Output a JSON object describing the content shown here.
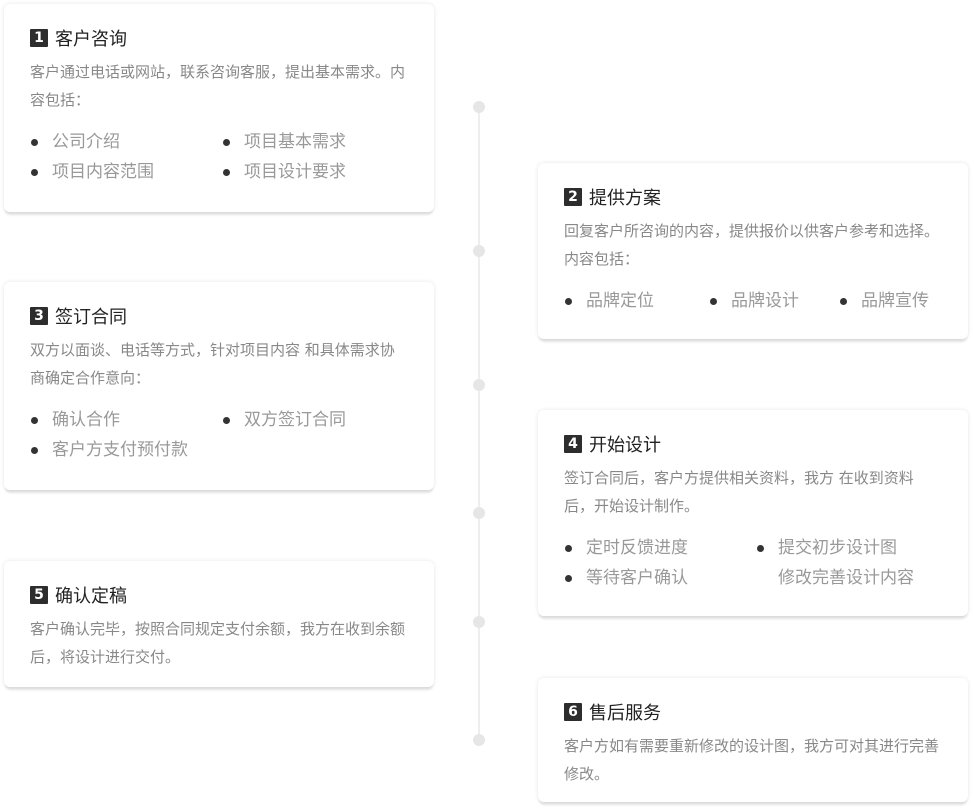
{
  "steps": [
    {
      "num": "1",
      "title": "客户咨询",
      "desc": "客户通过电话或网站，联系咨询客服，提出基本需求。内容包括：",
      "bullets": [
        "公司介绍",
        "项目基本需求",
        "项目内容范围",
        "项目设计要求"
      ]
    },
    {
      "num": "2",
      "title": "提供方案",
      "desc": "回复客户所咨询的内容，提供报价以供客户参考和选择。内容包括：",
      "bullets": [
        "品牌定位",
        "品牌设计",
        "品牌宣传"
      ]
    },
    {
      "num": "3",
      "title": "签订合同",
      "desc": "双方以面谈、电话等方式，针对项目内容 和具体需求协商确定合作意向：",
      "bullets": [
        "确认合作",
        "双方签订合同",
        "客户方支付预付款"
      ]
    },
    {
      "num": "4",
      "title": "开始设计",
      "desc": "签订合同后，客户方提供相关资料，我方 在收到资料后，开始设计制作。",
      "bullets": [
        "定时反馈进度",
        "提交初步设计图",
        "等待客户确认",
        "修改完善设计内容"
      ]
    },
    {
      "num": "5",
      "title": "确认定稿",
      "desc": "客户确认完毕，按照合同规定支付余额，我方在收到余额后，将设计进行交付。",
      "bullets": []
    },
    {
      "num": "6",
      "title": "售后服务",
      "desc": "客户方如有需要重新修改的设计图，我方可对其进行完善修改。",
      "bullets": []
    }
  ],
  "colors": {
    "badge": "#2d2d2d",
    "desc": "#888888",
    "bullet_text": "#999999",
    "line": "#eeeeee"
  }
}
